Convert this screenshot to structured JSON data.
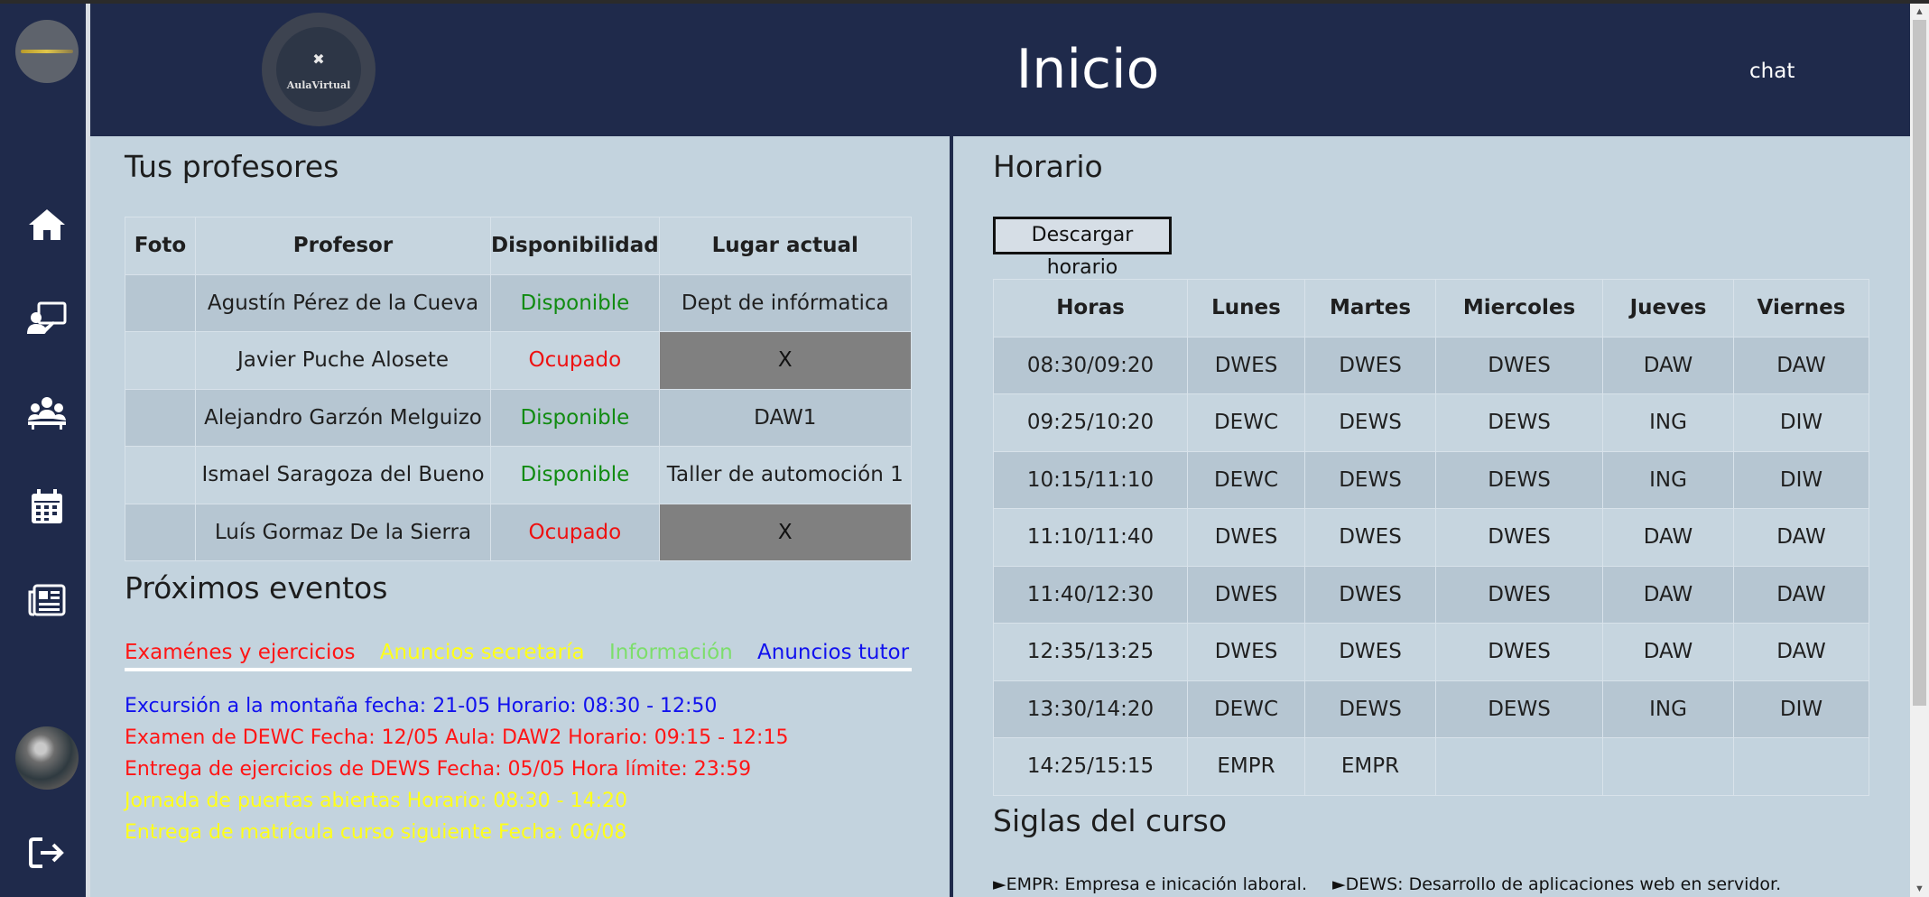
{
  "header": {
    "logo_text": "AulaVirtual",
    "title": "Inicio",
    "chat_label": "chat"
  },
  "sidebar": {
    "items": [
      {
        "icon": "home-icon"
      },
      {
        "icon": "teacher-board-icon"
      },
      {
        "icon": "group-meeting-icon"
      },
      {
        "icon": "calendar-icon"
      },
      {
        "icon": "newspaper-icon"
      }
    ],
    "logout_icon": "logout-icon"
  },
  "teachers": {
    "title": "Tus profesores",
    "columns": [
      "Foto",
      "Profesor",
      "Disponibilidad",
      "Lugar actual"
    ],
    "rows": [
      {
        "name": "Agustín Pérez de la Cueva",
        "status": "Disponible",
        "status_color": "#118b11",
        "location": "Dept de infórmatica"
      },
      {
        "name": "Javier Puche Alosete",
        "status": "Ocupado",
        "status_color": "#ee1111",
        "location": "X"
      },
      {
        "name": "Alejandro Garzón Melguizo",
        "status": "Disponible",
        "status_color": "#118b11",
        "location": "DAW1"
      },
      {
        "name": "Ismael Saragoza del Bueno",
        "status": "Disponible",
        "status_color": "#118b11",
        "location": "Taller de automoción 1"
      },
      {
        "name": "Luís Gormaz De la Sierra",
        "status": "Ocupado",
        "status_color": "#ee1111",
        "location": "X"
      }
    ]
  },
  "events": {
    "title": "Próximos eventos",
    "tabs": [
      {
        "label": "Examénes y ejercicios",
        "color": "#ff1515"
      },
      {
        "label": "Anuncios secretaría",
        "color": "#ffff1a"
      },
      {
        "label": "Información",
        "color": "#7dde6b"
      },
      {
        "label": "Anuncios tutor",
        "color": "#1111ee"
      }
    ],
    "items": [
      {
        "text": "Excursión a la montaña fecha: 21-05 Horario: 08:30 - 12:50",
        "color": "#1111ee"
      },
      {
        "text": "Examen de DEWC Fecha: 12/05 Aula: DAW2 Horario: 09:15 - 12:15",
        "color": "#ff1515"
      },
      {
        "text": "Entrega de ejercicios de DEWS Fecha: 05/05 Hora límite: 23:59",
        "color": "#ff1515"
      },
      {
        "text": "Jornada de puertas abiertas Horario: 08:30 - 14:20",
        "color": "#ffff1a"
      },
      {
        "text": "Entrega de matrícula curso siguiente Fecha: 06/08",
        "color": "#ffff1a"
      }
    ]
  },
  "schedule": {
    "title": "Horario",
    "download_label": "Descargar horario",
    "columns": [
      "Horas",
      "Lunes",
      "Martes",
      "Miercoles",
      "Jueves",
      "Viernes"
    ],
    "rows": [
      [
        "08:30/09:20",
        "DWES",
        "DWES",
        "DWES",
        "DAW",
        "DAW"
      ],
      [
        "09:25/10:20",
        "DEWC",
        "DEWS",
        "DEWS",
        "ING",
        "DIW"
      ],
      [
        "10:15/11:10",
        "DEWC",
        "DEWS",
        "DEWS",
        "ING",
        "DIW"
      ],
      [
        "11:10/11:40",
        "DWES",
        "DWES",
        "DWES",
        "DAW",
        "DAW"
      ],
      [
        "11:40/12:30",
        "DWES",
        "DWES",
        "DWES",
        "DAW",
        "DAW"
      ],
      [
        "12:35/13:25",
        "DWES",
        "DWES",
        "DWES",
        "DAW",
        "DAW"
      ],
      [
        "13:30/14:20",
        "DEWC",
        "DEWS",
        "DEWS",
        "ING",
        "DIW"
      ],
      [
        "14:25/15:15",
        "EMPR",
        "EMPR",
        "",
        "",
        ""
      ]
    ]
  },
  "acronyms": {
    "title": "Siglas del curso",
    "items": [
      "►EMPR: Empresa e inicación laboral.",
      "►DEWS: Desarrollo de aplicaciones web en servidor."
    ]
  }
}
